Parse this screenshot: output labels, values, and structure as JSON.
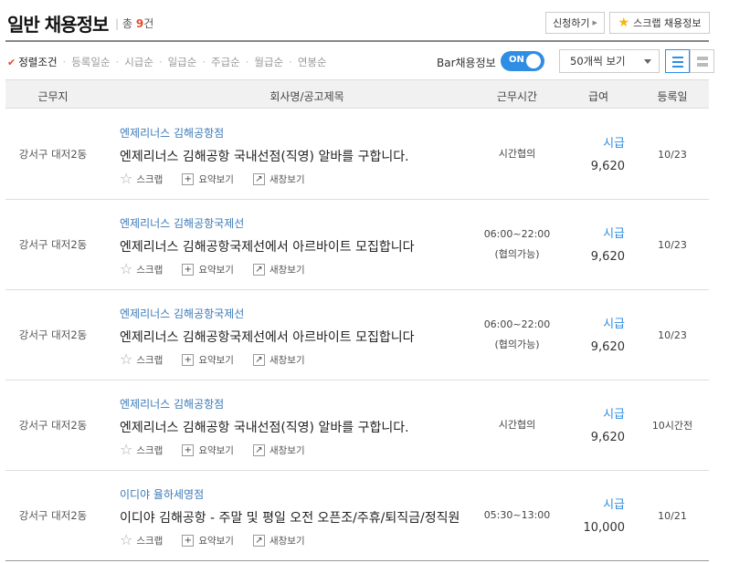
{
  "header": {
    "title": "일반 채용정보",
    "count_prefix": "총",
    "count_value": "9",
    "count_suffix": "건",
    "apply_button": "신청하기",
    "scrap_button": "스크랩 채용정보"
  },
  "sort": {
    "items": [
      "정렬조건",
      "등록일순",
      "시급순",
      "일급순",
      "주급순",
      "월급순",
      "연봉순"
    ],
    "active_index": 0,
    "bar_label": "Bar채용정보",
    "toggle_label": "ON",
    "toggle_on": true,
    "per_page": "50개씩 보기"
  },
  "columns": {
    "location": "근무지",
    "title": "회사명/공고제목",
    "hours": "근무시간",
    "pay": "급여",
    "date": "등록일"
  },
  "actions": {
    "scrap": "스크랩",
    "summary": "요약보기",
    "new_window": "새창보기"
  },
  "rows": [
    {
      "location": "강서구 대저2동",
      "company": "엔제리너스 김해공항점",
      "title": "엔제리너스 김해공항 국내선점(직영) 알바를 구합니다.",
      "hours_line1": "시간협의",
      "hours_line2": "",
      "pay_type": "시급",
      "pay": "9,620",
      "date": "10/23"
    },
    {
      "location": "강서구 대저2동",
      "company": "엔제리너스 김해공항국제선",
      "title": "엔제리너스 김해공항국제선에서 아르바이트 모집합니다",
      "hours_line1": "06:00~22:00",
      "hours_line2": "(협의가능)",
      "pay_type": "시급",
      "pay": "9,620",
      "date": "10/23"
    },
    {
      "location": "강서구 대저2동",
      "company": "엔제리너스 김해공항국제선",
      "title": "엔제리너스 김해공항국제선에서 아르바이트 모집합니다",
      "hours_line1": "06:00~22:00",
      "hours_line2": "(협의가능)",
      "pay_type": "시급",
      "pay": "9,620",
      "date": "10/23"
    },
    {
      "location": "강서구 대저2동",
      "company": "엔제리너스 김해공항점",
      "title": "엔제리너스 김해공항 국내선점(직영) 알바를 구합니다.",
      "hours_line1": "시간협의",
      "hours_line2": "",
      "pay_type": "시급",
      "pay": "9,620",
      "date": "10시간전"
    },
    {
      "location": "강서구 대저2동",
      "company": "이디야 율하세영점",
      "title": "이디야 김해공항 - 주말 및 평일 오전 오픈조/주휴/퇴직금/정직원",
      "hours_line1": "05:30~13:00",
      "hours_line2": "",
      "pay_type": "시급",
      "pay": "10,000",
      "date": "10/21"
    }
  ],
  "colors": {
    "accent": "#2f8de4",
    "count": "#e8492c",
    "company_link": "#3d7ab8"
  }
}
